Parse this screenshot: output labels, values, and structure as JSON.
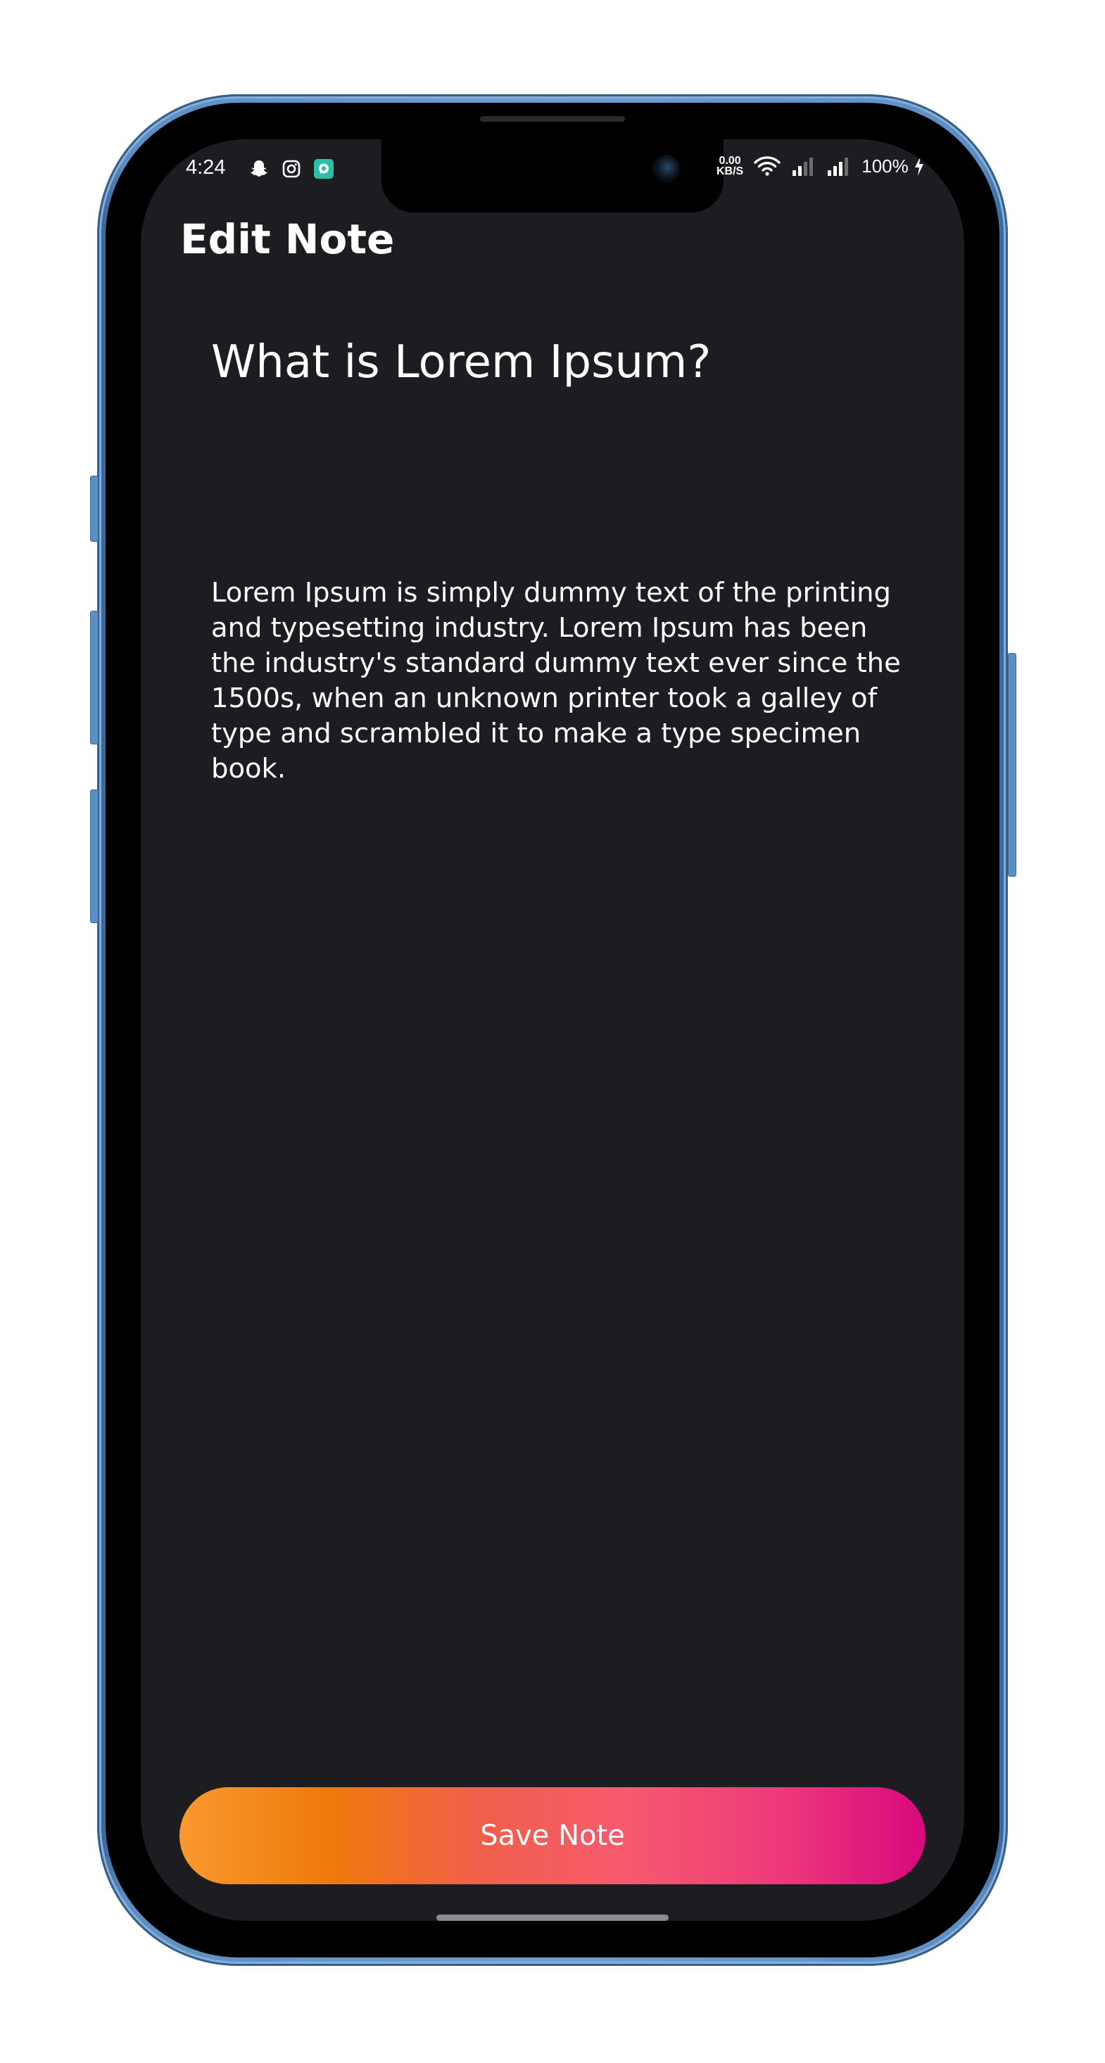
{
  "status_bar": {
    "time": "4:24",
    "net_speed_value": "0.00",
    "net_speed_unit": "KB/S",
    "battery": "100%",
    "left_icons": [
      "snapchat-icon",
      "instagram-icon",
      "chat-app-icon"
    ],
    "right_icons": [
      "wifi-icon",
      "signal-icon",
      "signal-icon",
      "charging-icon"
    ]
  },
  "header": {
    "title": "Edit Note"
  },
  "note": {
    "title": "What is Lorem Ipsum?",
    "body": "Lorem Ipsum is simply dummy text of the printing and typesetting industry. Lorem Ipsum has been the industry's standard dummy text ever since the 1500s, when an unknown printer took a galley of type and scrambled it to make a type specimen book."
  },
  "actions": {
    "save_label": "Save Note"
  },
  "colors": {
    "screen_background": "#1d1c21",
    "text": "#ffffff",
    "button_gradient_start": "#f99930",
    "button_gradient_end": "#d8097e",
    "phone_frame": "#5b8fc3"
  }
}
